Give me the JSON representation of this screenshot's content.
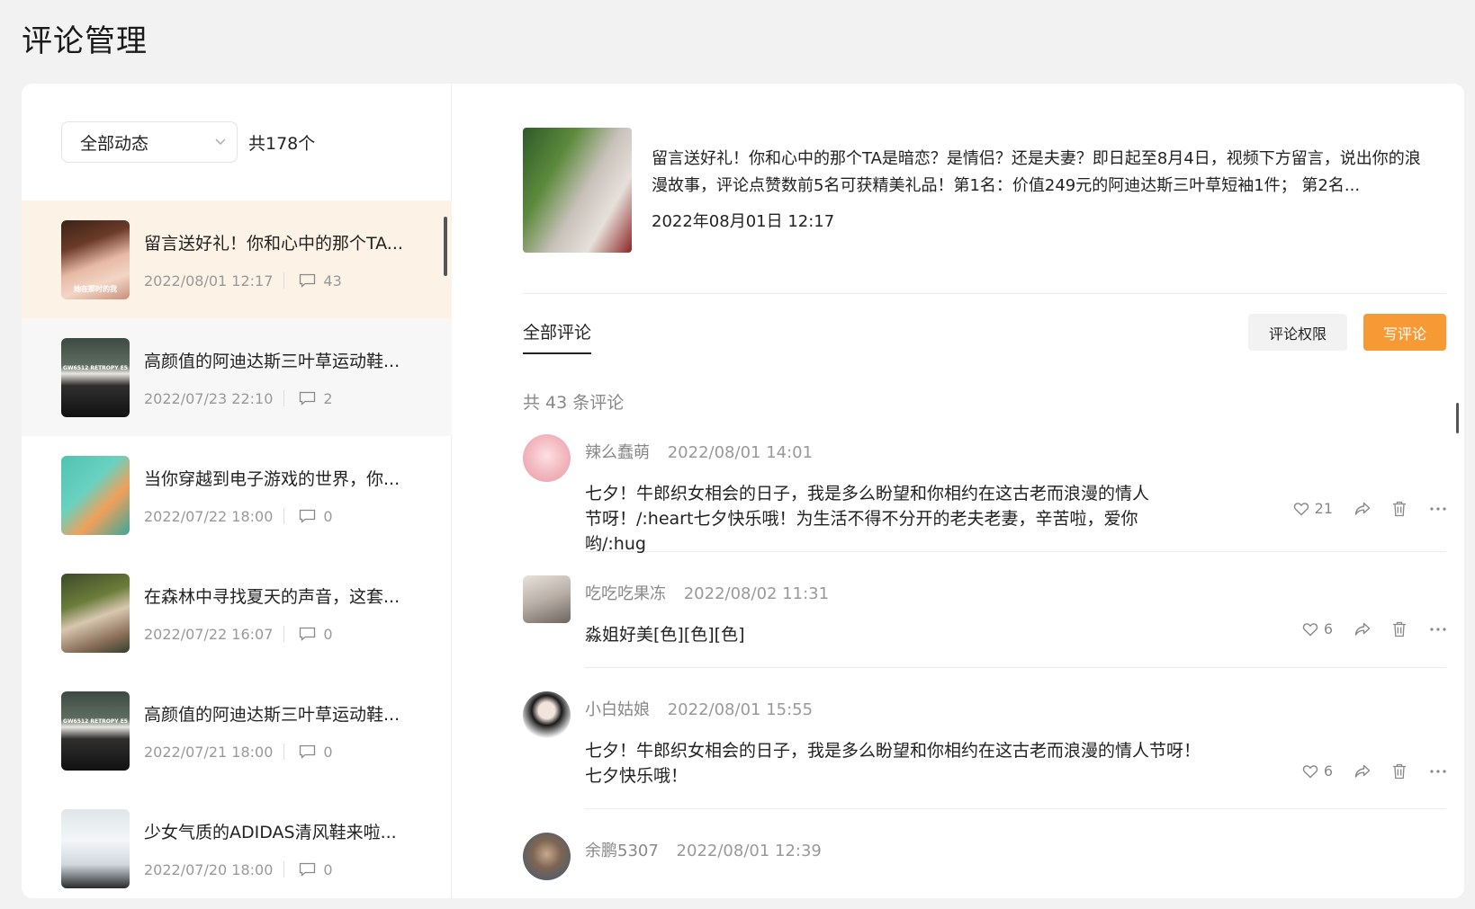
{
  "page_title": "评论管理",
  "filter": {
    "selected": "全部动态",
    "count": "共178个"
  },
  "posts": [
    {
      "title": "留言送好礼！你和心中的那个TA...",
      "date": "2022/08/01 12:17",
      "comments": "43",
      "thumb_caption": "她在那时的我"
    },
    {
      "title": "高颜值的阿迪达斯三叶草运动鞋...",
      "date": "2022/07/23 22:10",
      "comments": "2",
      "thumb_caption": "GW6512 RETROPY E5"
    },
    {
      "title": "当你穿越到电子游戏的世界，你...",
      "date": "2022/07/22 18:00",
      "comments": "0",
      "thumb_caption": ""
    },
    {
      "title": "在森林中寻找夏天的声音，这套...",
      "date": "2022/07/22 16:07",
      "comments": "0",
      "thumb_caption": ""
    },
    {
      "title": "高颜值的阿迪达斯三叶草运动鞋...",
      "date": "2022/07/21 18:00",
      "comments": "0",
      "thumb_caption": "GW6512 RETROPY E5"
    },
    {
      "title": "少女气质的ADIDAS清风鞋来啦...",
      "date": "2022/07/20 18:00",
      "comments": "0",
      "thumb_caption": ""
    }
  ],
  "detail": {
    "description": "留言送好礼！你和心中的那个TA是暗恋？是情侣？还是夫妻？即日起至8月4日，视频下方留言，说出你的浪漫故事，评论点赞数前5名可获精美礼品！第1名：价值249元的阿迪达斯三叶草短袖1件；  第2名...",
    "date": "2022年08月01日 12:17"
  },
  "tabs": {
    "all_comments": "全部评论"
  },
  "buttons": {
    "permission": "评论权限",
    "write": "写评论"
  },
  "total_text": "共 43 条评论",
  "comments": [
    {
      "name": "辣么蠢萌",
      "time": "2022/08/01 14:01",
      "text": "七夕！牛郎织女相会的日子，我是多么盼望和你相约在这古老而浪漫的情人节呀！/:heart七夕快乐哦！为生活不得不分开的老夫老妻，辛苦啦，爱你哟/:hug",
      "likes": "21"
    },
    {
      "name": "吃吃吃果冻",
      "time": "2022/08/02 11:31",
      "text": "淼姐好美[色][色][色]",
      "likes": "6"
    },
    {
      "name": "小白姑娘",
      "time": "2022/08/01 15:55",
      "text": "七夕！牛郎织女相会的日子，我是多么盼望和你相约在这古老而浪漫的情人节呀！七夕快乐哦！",
      "likes": "6"
    },
    {
      "name": "余鹏5307",
      "time": "2022/08/01 12:39",
      "text": "",
      "likes": ""
    }
  ],
  "colors": {
    "accent": "#f79a35",
    "active_row": "#fdf2e6"
  }
}
